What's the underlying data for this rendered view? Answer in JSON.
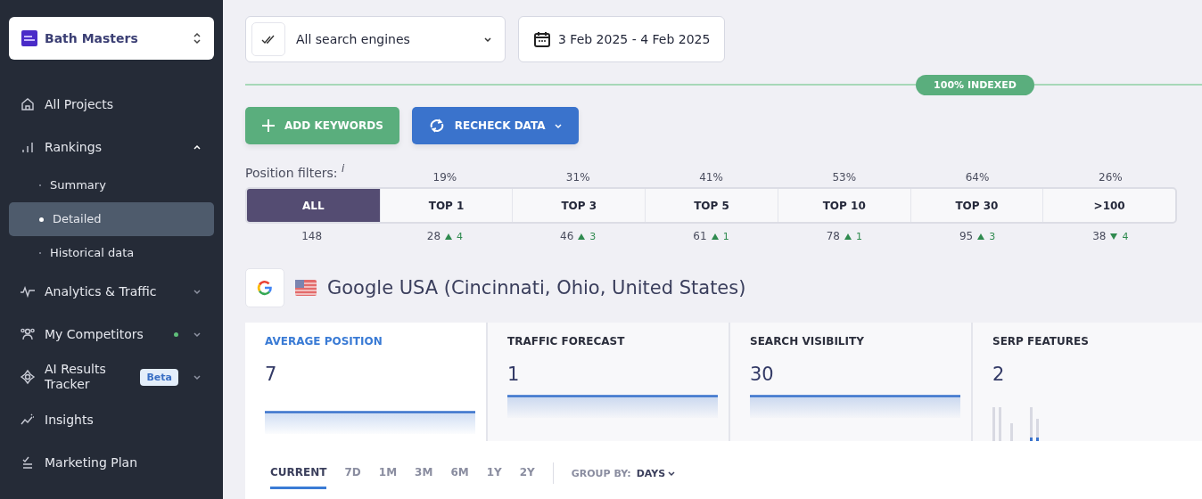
{
  "project": {
    "name": "Bath Masters"
  },
  "nav": [
    {
      "kind": "home",
      "label": "All Projects"
    },
    {
      "kind": "bars",
      "label": "Rankings",
      "expanded": true,
      "children": [
        {
          "label": "Summary",
          "selected": false
        },
        {
          "label": "Detailed",
          "selected": true
        },
        {
          "label": "Historical data",
          "selected": false
        }
      ]
    },
    {
      "kind": "pulse",
      "label": "Analytics & Traffic",
      "expanded": false
    },
    {
      "kind": "people",
      "label": "My Competitors",
      "expanded": false,
      "color": "#5fbf7a"
    },
    {
      "kind": "ai",
      "label": "AI Results Tracker",
      "expanded": false,
      "badge": "Beta"
    },
    {
      "kind": "spark",
      "label": "Insights"
    },
    {
      "kind": "plan",
      "label": "Marketing Plan"
    }
  ],
  "toolbar": {
    "engine_select": {
      "value": "All search engines"
    },
    "date_range": {
      "value": "3 Feb 2025 - 4 Feb 2025"
    }
  },
  "index_status": {
    "label": "100% INDEXED"
  },
  "actions": [
    {
      "kind": "add",
      "label": "ADD KEYWORDS"
    },
    {
      "kind": "recheck",
      "label": "RECHECK DATA"
    }
  ],
  "position_filters": {
    "label": "Position filters:",
    "info": "i",
    "filters": [
      {
        "label": "ALL",
        "count": "148",
        "selected": true
      },
      {
        "label": "TOP 1",
        "percent": "19%",
        "count": "28",
        "change": "4",
        "rising": true,
        "selected": false
      },
      {
        "label": "TOP 3",
        "percent": "31%",
        "count": "46",
        "change": "3",
        "rising": true,
        "selected": false
      },
      {
        "label": "TOP 5",
        "percent": "41%",
        "count": "61",
        "change": "1",
        "rising": true,
        "selected": false
      },
      {
        "label": "TOP 10",
        "percent": "53%",
        "count": "78",
        "change": "1",
        "rising": true,
        "selected": false
      },
      {
        "label": "TOP 30",
        "percent": "64%",
        "count": "95",
        "change": "3",
        "rising": true,
        "selected": false
      },
      {
        "label": ">100",
        "percent": "26%",
        "count": "38",
        "change": "4",
        "rising": false,
        "selected": false
      }
    ]
  },
  "search_engine": {
    "title": "Google USA (Cincinnati, Ohio, United States)"
  },
  "metrics": [
    {
      "kind": "line",
      "title": "AVERAGE POSITION",
      "value": "7",
      "selected": true
    },
    {
      "kind": "line",
      "title": "TRAFFIC FORECAST",
      "value": "1",
      "selected": false
    },
    {
      "kind": "line",
      "title": "SEARCH VISIBILITY",
      "value": "30",
      "selected": false
    },
    {
      "kind": "bars",
      "title": "SERP FEATURES",
      "value": "2",
      "selected": false
    }
  ],
  "periods": [
    {
      "label": "CURRENT",
      "selected": true
    },
    {
      "label": "7D",
      "selected": false
    },
    {
      "label": "1M",
      "selected": false
    },
    {
      "label": "3M",
      "selected": false
    },
    {
      "label": "6M",
      "selected": false
    },
    {
      "label": "1Y",
      "selected": false
    },
    {
      "label": "2Y",
      "selected": false
    }
  ],
  "group_by": {
    "label": "GROUP BY:",
    "value": "DAYS"
  }
}
